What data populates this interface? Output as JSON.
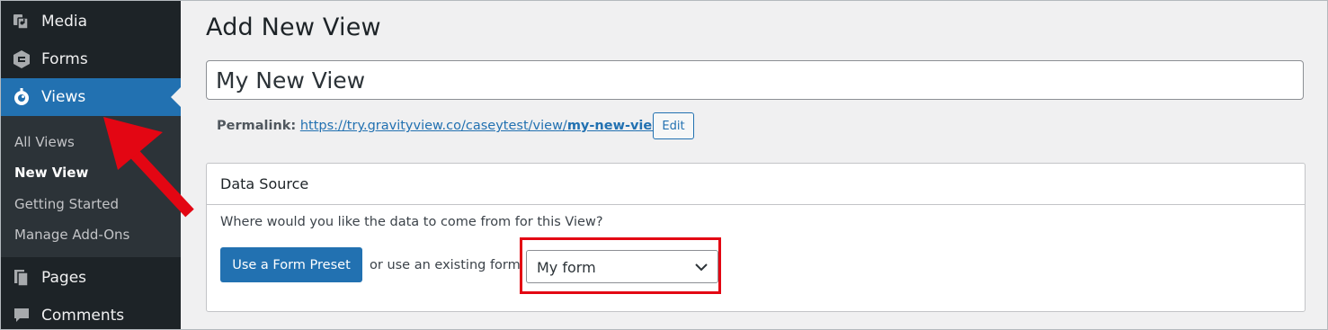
{
  "sidebar": {
    "items_top": [
      {
        "label": "Media",
        "icon": "media-icon"
      },
      {
        "label": "Forms",
        "icon": "gravity-forms-icon"
      },
      {
        "label": "Views",
        "icon": "gravityview-icon"
      }
    ],
    "submenu": [
      {
        "label": "All Views"
      },
      {
        "label": "New View"
      },
      {
        "label": "Getting Started"
      },
      {
        "label": "Manage Add-Ons"
      }
    ],
    "items_bottom": [
      {
        "label": "Pages",
        "icon": "pages-icon"
      },
      {
        "label": "Comments",
        "icon": "comments-icon"
      }
    ],
    "accent_color": "#2271b1",
    "background_color": "#1d2327"
  },
  "main": {
    "title": "Add New View",
    "title_input_value": "My New View",
    "permalink": {
      "label": "Permalink:",
      "url_base": "https://try.gravityview.co/caseytest/view/",
      "url_slug": "my-new-view",
      "url_trail": "/",
      "edit_label": "Edit"
    },
    "data_source": {
      "title": "Data Source",
      "question": "Where would you like the data to come from for this View?",
      "preset_button": "Use a Form Preset",
      "or_text": "or use an existing form",
      "selected_form": "My form"
    }
  },
  "annotations": {
    "arrow_color": "#e30613",
    "highlight_color": "#e30613"
  }
}
